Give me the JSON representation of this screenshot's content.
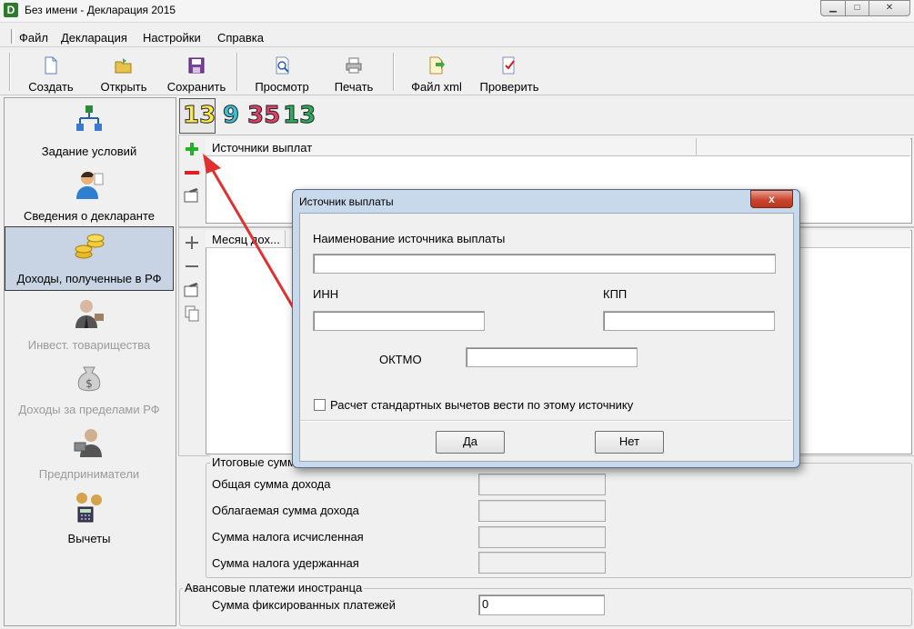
{
  "window": {
    "app_icon_letter": "D",
    "title": "Без имени - Декларация 2015",
    "minimize": "▁",
    "maximize": "□",
    "close": "✕"
  },
  "menu": [
    "Файл",
    "Декларация",
    "Настройки",
    "Справка"
  ],
  "toolbar": {
    "create": "Создать",
    "open": "Открыть",
    "save": "Сохранить",
    "preview": "Просмотр",
    "print": "Печать",
    "xml": "Файл xml",
    "check": "Проверить"
  },
  "nav": [
    {
      "label": "Задание условий",
      "icon": "flowchart-icon",
      "enabled": true
    },
    {
      "label": "Сведения о декларанте",
      "icon": "person-icon",
      "enabled": true
    },
    {
      "label": "Доходы, полученные в РФ",
      "icon": "coins-icon",
      "enabled": true,
      "active": true
    },
    {
      "label": "Инвест. товарищества",
      "icon": "businessman-icon",
      "enabled": false
    },
    {
      "label": "Доходы за пределами РФ",
      "icon": "money-bag-icon",
      "enabled": false
    },
    {
      "label": "Предприниматели",
      "icon": "entrepreneur-icon",
      "enabled": false
    },
    {
      "label": "Вычеты",
      "icon": "calculator-icon",
      "enabled": true
    }
  ],
  "tax_rates": [
    "13",
    "9",
    "35",
    "13"
  ],
  "sources_grid": {
    "header": "Источники выплат"
  },
  "income_grid": {
    "header": "Месяц дох..."
  },
  "totals": {
    "title": "Итоговые суммы",
    "rows": [
      "Общая сумма дохода",
      "Облагаемая сумма дохода",
      "Сумма налога исчисленная",
      "Сумма налога удержанная"
    ]
  },
  "advance": {
    "title": "Авансовые платежи иностранца",
    "label": "Сумма фиксированных платежей",
    "value": "0"
  },
  "dialog": {
    "title": "Источник выплаты",
    "close": "x",
    "name_label": "Наименование источника выплаты",
    "name_value": "",
    "inn_label": "ИНН",
    "inn_value": "",
    "kpp_label": "КПП",
    "kpp_value": "",
    "oktmo_label": "ОКТМО",
    "oktmo_value": "",
    "checkbox_label": "Расчет стандартных вычетов вести по этому источнику",
    "checkbox_checked": false,
    "yes": "Да",
    "no": "Нет"
  },
  "colors": {
    "tax13_fill": "#ffe84a",
    "tax9_fill": "#38c4d6",
    "tax35_fill": "#e0406a",
    "tax13b_fill": "#28b05c",
    "arrow": "#e03030",
    "dialog_frame": "#c9d9ec"
  }
}
